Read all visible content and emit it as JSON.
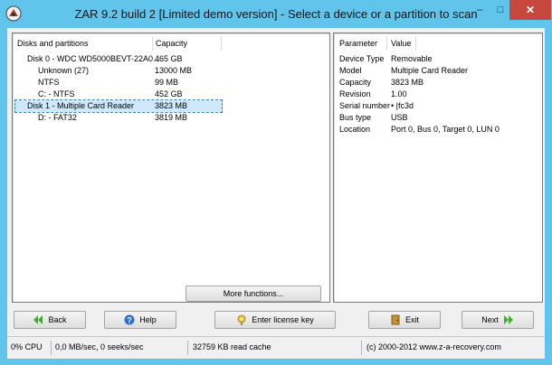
{
  "window": {
    "title": "ZAR 9.2 build 2 [Limited demo version] - Select a device or a partition to scan",
    "minimize": "–",
    "maximize": "□",
    "close": "✕"
  },
  "devices": {
    "columns": [
      "Disks and partitions",
      "Capacity"
    ],
    "rows": [
      {
        "name": "Disk 0 - WDC WD5000BEVT-22A0...",
        "capacity": "465 GB"
      },
      {
        "name": "Unknown (27)",
        "capacity": "13000 MB"
      },
      {
        "name": "NTFS",
        "capacity": "99 MB"
      },
      {
        "name": "C: - NTFS",
        "capacity": "452 GB"
      },
      {
        "name": "Disk 1 - Multiple Card  Reader",
        "capacity": "3823 MB"
      },
      {
        "name": "D: - FAT32",
        "capacity": "3819 MB"
      }
    ]
  },
  "properties": {
    "columns": [
      "Parameter",
      "Value"
    ],
    "rows": [
      {
        "param": "Device Type",
        "value": "Removable"
      },
      {
        "param": "Model",
        "value": "Multiple Card  Reader"
      },
      {
        "param": "Capacity",
        "value": "3823 MB"
      },
      {
        "param": "Revision",
        "value": "1.00"
      },
      {
        "param": "Serial number",
        "value": "• |fc3d"
      },
      {
        "param": "Bus type",
        "value": "USB"
      },
      {
        "param": "Location",
        "value": "Port 0, Bus 0, Target 0, LUN 0"
      }
    ]
  },
  "buttons": {
    "more_functions": "More functions...",
    "back": "Back",
    "help": "Help",
    "license": "Enter license key",
    "exit": "Exit",
    "next": "Next"
  },
  "status": {
    "cpu": "0% CPU",
    "io": "0,0 MB/sec, 0 seeks/sec",
    "cache": "32759 KB read cache",
    "copyright": "(c) 2000-2012 www.z-a-recovery.com"
  },
  "colors": {
    "frame": "#61c5eb",
    "close_button": "#c7463d",
    "selection": "#cfe8fb",
    "nav_arrow": "#3fae2a"
  }
}
